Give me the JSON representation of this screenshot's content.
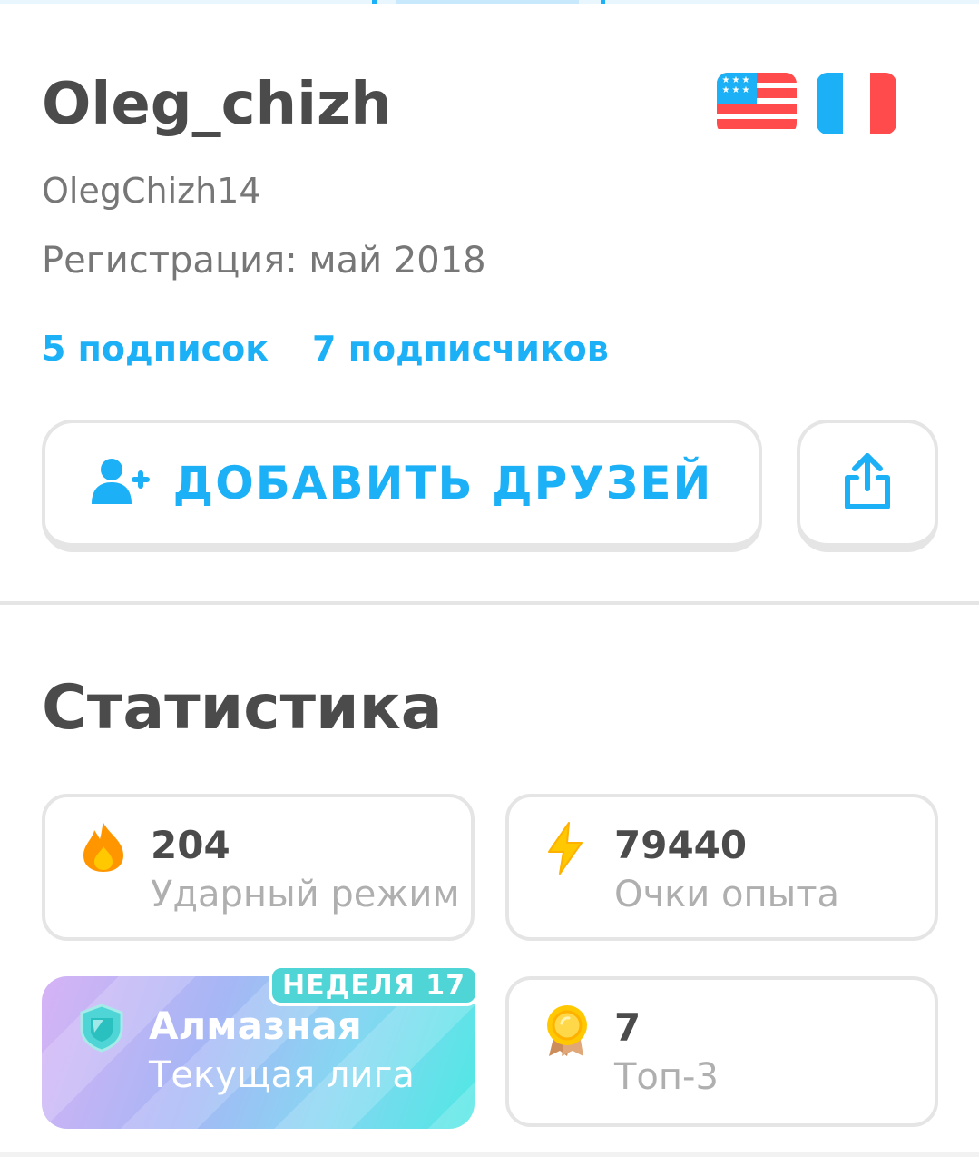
{
  "profile": {
    "display_name": "Oleg_chizh",
    "username": "OlegChizh14",
    "registered": "Регистрация: май 2018",
    "following": "5 подписок",
    "followers": "7 подписчиков",
    "languages": [
      {
        "icon": "us-flag-icon",
        "colors": [
          "#1cb0f6",
          "#ff4b4b",
          "#ffffff"
        ]
      },
      {
        "icon": "france-flag-icon",
        "colors": [
          "#1cb0f6",
          "#ffffff",
          "#ff4b4b"
        ]
      }
    ]
  },
  "actions": {
    "add_friends_label": "ДОБАВИТЬ ДРУЗЕЙ",
    "add_friends_icon": "add-person-icon",
    "share_icon": "share-icon"
  },
  "stats": {
    "title": "Статистика",
    "streak": {
      "value": "204",
      "label": "Ударный режим",
      "icon": "fire-icon"
    },
    "xp": {
      "value": "79440",
      "label": "Очки опыта",
      "icon": "lightning-icon"
    },
    "league": {
      "value": "Алмазная",
      "label": "Текущая лига",
      "badge": "НЕДЕЛЯ 17",
      "icon": "diamond-league-icon"
    },
    "top3": {
      "value": "7",
      "label": "Топ-3",
      "icon": "medal-icon"
    }
  },
  "colors": {
    "accent": "#1cb0f6",
    "text": "#4b4b4b",
    "muted": "#777777",
    "border": "#e5e5e5",
    "flame": "#ff9600",
    "xp": "#ffc800"
  }
}
